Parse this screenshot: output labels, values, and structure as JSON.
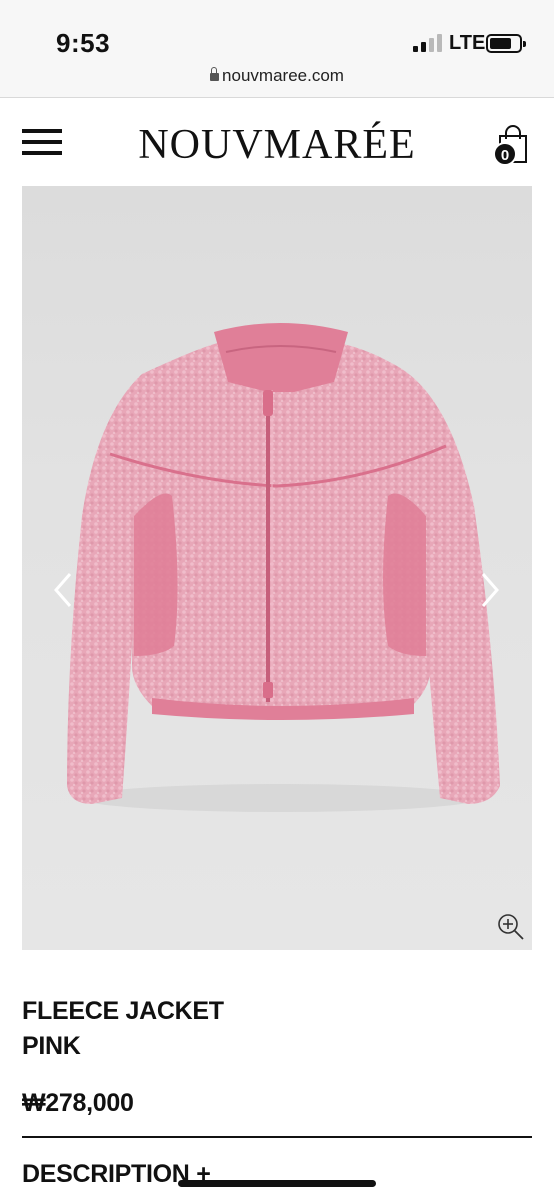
{
  "status_bar": {
    "time": "9:53",
    "network": "LTE",
    "battery_level": 0.75,
    "url": "nouvmaree.com"
  },
  "header": {
    "brand": "NOUVMARÉE",
    "cart_count": "0",
    "icons": [
      "menu-icon",
      "shopping-bag-icon"
    ]
  },
  "gallery": {
    "icons": [
      "chevron-left-icon",
      "chevron-right-icon",
      "zoom-in-icon"
    ],
    "colors": {
      "background": "#e0e0e0",
      "fleece": "#e9a6b8",
      "nylon_panel": "#e07f98",
      "trim": "#d9708c"
    }
  },
  "product": {
    "name_line1": "FLEECE JACKET",
    "name_line2": "PINK",
    "price": "₩278,000",
    "description_label": "DESCRIPTION +"
  }
}
